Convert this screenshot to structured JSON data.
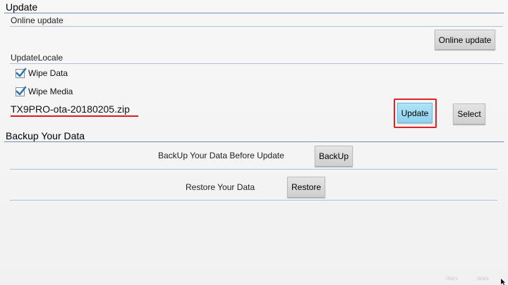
{
  "update_section": {
    "title": "Update",
    "online_update_title": "Online update",
    "online_update_button": "Online update",
    "update_locale_title": "UpdateLocale",
    "wipe_data_label": "Wipe Data",
    "wipe_data_checked": true,
    "wipe_media_label": "Wipe Media",
    "wipe_media_checked": true,
    "filename": "TX9PRO-ota-20180205.zip",
    "update_button": "Update",
    "select_button": "Select"
  },
  "backup_section": {
    "title": "Backup Your Data",
    "backup_label": "BackUp Your Data Before Update",
    "backup_button": "BackUp",
    "restore_label": "Restore Your Data",
    "restore_button": "Restore"
  },
  "status_bar": {
    "left": "0kb/s",
    "right": "0kb/s"
  },
  "colors": {
    "focus_ring": "#e32024",
    "accent_button": "#9ad8f2",
    "divider": "#aebfd7",
    "checkbox_check": "#2f76b7"
  }
}
